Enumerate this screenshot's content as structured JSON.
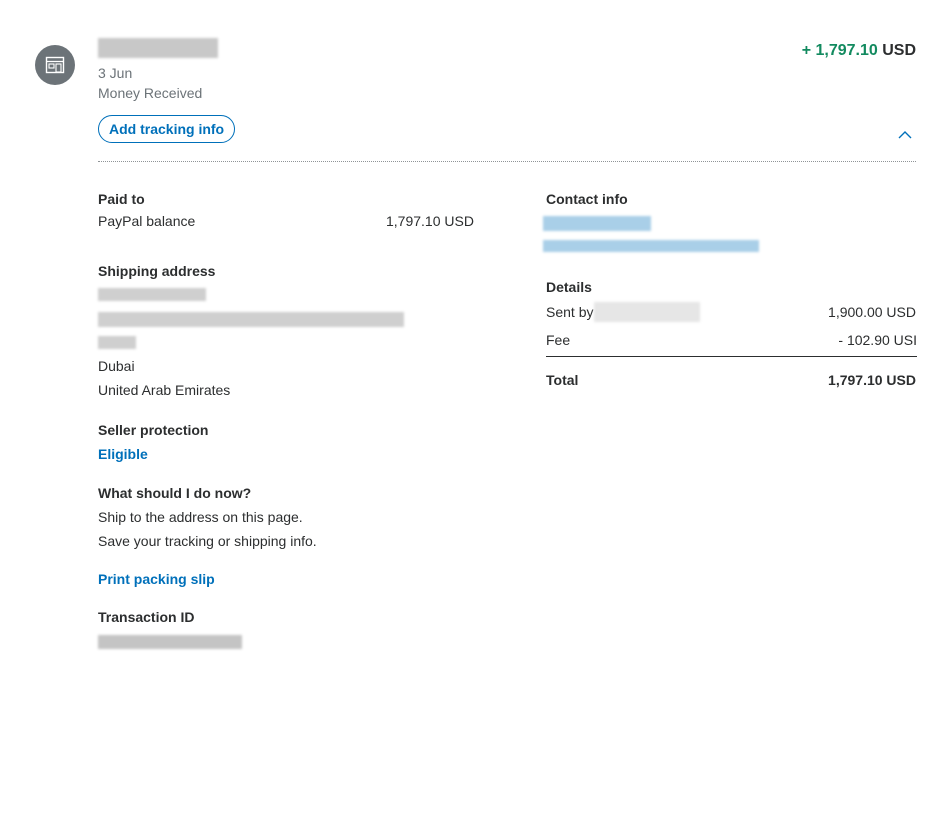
{
  "transaction": {
    "date": "3 Jun",
    "type": "Money Received",
    "amount_sign_value": "+ 1,797.10",
    "amount_currency": "USD",
    "add_tracking_label": "Add tracking info"
  },
  "paid_to": {
    "heading": "Paid to",
    "account": "PayPal balance",
    "amount": "1,797.10 USD"
  },
  "shipping": {
    "heading": "Shipping address",
    "city": "Dubai",
    "country": "United Arab Emirates"
  },
  "seller_protection": {
    "heading": "Seller protection",
    "status": "Eligible"
  },
  "next_steps": {
    "heading": "What should I do now?",
    "line1": "Ship to the address on this page.",
    "line2": "Save your tracking or shipping info.",
    "print_label": "Print packing slip"
  },
  "transaction_id": {
    "heading": "Transaction ID"
  },
  "contact": {
    "heading": "Contact info"
  },
  "details": {
    "heading": "Details",
    "sent_by_label": "Sent by",
    "sent_by_amount": "1,900.00 USD",
    "fee_label": "Fee",
    "fee_amount": "- 102.90 USI",
    "total_label": "Total",
    "total_amount": "1,797.10 USD"
  },
  "icons": {
    "merchant": "storefront-icon",
    "collapse": "chevron-up-icon"
  },
  "colors": {
    "accent": "#0070ba",
    "positive": "#128a5f",
    "text": "#2c2e2f",
    "muted": "#6c7378"
  }
}
